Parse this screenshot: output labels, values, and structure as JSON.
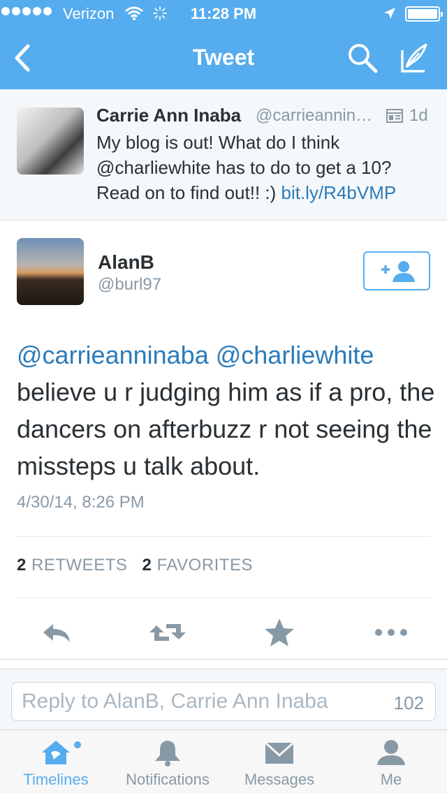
{
  "status_bar": {
    "carrier": "Verizon",
    "time": "11:28 PM",
    "signal_dots": 5,
    "battery_level": 1.0
  },
  "nav": {
    "title": "Tweet",
    "back_icon": "chevron-left-icon",
    "search_icon": "search-icon",
    "compose_icon": "compose-feather-icon"
  },
  "original_tweet": {
    "name": "Carrie Ann Inaba",
    "handle": "@carrieanninaba",
    "time": "1d",
    "text": "My blog is out!  What do I think @charliewhite has to do to get a 10? Read on to find out!! :) ",
    "link": "bit.ly/R4bVMP"
  },
  "tweet": {
    "author_name": "AlanB",
    "author_handle": "@burl97",
    "mention_1": "@carrieanninaba",
    "mention_2": "@charliewhite",
    "body": "believe u r judging him as if a pro, the dancers on afterbuzz r not seeing the missteps u talk about.",
    "date": "4/30/14, 8:26 PM",
    "retweets_count": "2",
    "retweets_label": "RETWEETS",
    "favorites_count": "2",
    "favorites_label": "FAVORITES"
  },
  "reply": {
    "placeholder": "Reply to AlanB, Carrie Ann Inaba",
    "remaining": "102"
  },
  "tabs": [
    {
      "label": "Timelines",
      "icon": "home-icon",
      "active": true
    },
    {
      "label": "Notifications",
      "icon": "bell-icon",
      "active": false
    },
    {
      "label": "Messages",
      "icon": "envelope-icon",
      "active": false
    },
    {
      "label": "Me",
      "icon": "person-icon",
      "active": false
    }
  ],
  "colors": {
    "brand_blue": "#55acee",
    "link_blue": "#2b7bb9",
    "secondary_text": "#8899a6",
    "icon_gray": "#8899a6"
  }
}
